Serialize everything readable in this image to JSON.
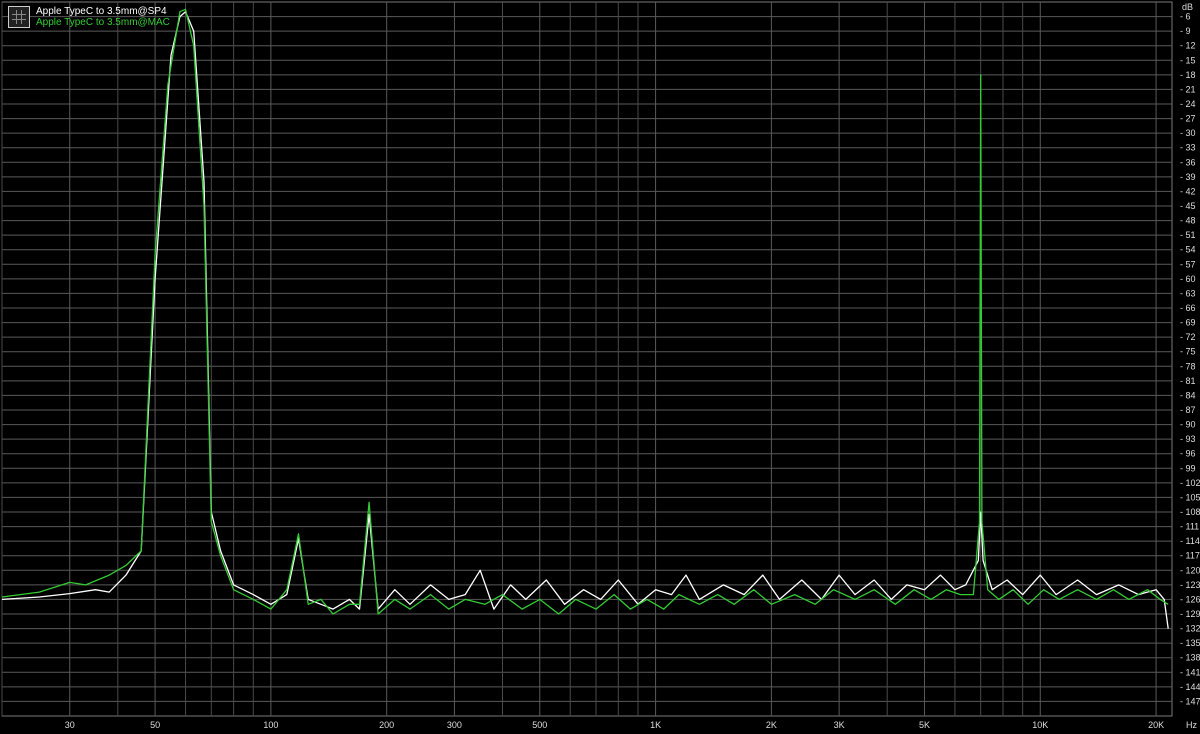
{
  "chart_data": {
    "type": "line",
    "title": "",
    "x_scale": "log",
    "xlim": [
      20,
      22000
    ],
    "ylim": [
      -150,
      -3
    ],
    "y_unit": "dB",
    "x_unit": "Hz",
    "grid": true,
    "legend_position": "top-left",
    "x_ticks": [
      {
        "value": 30,
        "label": "30"
      },
      {
        "value": 50,
        "label": "50"
      },
      {
        "value": 100,
        "label": "100"
      },
      {
        "value": 200,
        "label": "200"
      },
      {
        "value": 300,
        "label": "300"
      },
      {
        "value": 500,
        "label": "500"
      },
      {
        "value": 1000,
        "label": "1K"
      },
      {
        "value": 2000,
        "label": "2K"
      },
      {
        "value": 3000,
        "label": "3K"
      },
      {
        "value": 5000,
        "label": "5K"
      },
      {
        "value": 10000,
        "label": "10K"
      },
      {
        "value": 20000,
        "label": "20K"
      }
    ],
    "x_minor_grid": [
      20,
      40,
      60,
      70,
      80,
      90,
      400,
      600,
      700,
      800,
      900,
      4000,
      6000,
      7000,
      8000,
      9000
    ],
    "y_ticks": [
      -6,
      -9,
      -12,
      -15,
      -18,
      -21,
      -24,
      -27,
      -30,
      -33,
      -36,
      -39,
      -42,
      -45,
      -48,
      -51,
      -54,
      -57,
      -60,
      -63,
      -66,
      -69,
      -72,
      -75,
      -78,
      -81,
      -84,
      -87,
      -90,
      -93,
      -96,
      -99,
      -102,
      -105,
      -108,
      -111,
      -114,
      -117,
      -120,
      -123,
      -126,
      -129,
      -132,
      -135,
      -138,
      -141,
      -144,
      -147
    ],
    "series": [
      {
        "name": "Apple TypeC to 3.5mm@SP4",
        "color": "#ffffff",
        "points": [
          [
            20,
            -126
          ],
          [
            25,
            -125.5
          ],
          [
            30,
            -124.8
          ],
          [
            35,
            -124
          ],
          [
            38,
            -124.5
          ],
          [
            42,
            -121
          ],
          [
            46,
            -116
          ],
          [
            50,
            -60
          ],
          [
            55,
            -14
          ],
          [
            58,
            -6
          ],
          [
            60,
            -5
          ],
          [
            63,
            -9
          ],
          [
            67,
            -40
          ],
          [
            70,
            -108
          ],
          [
            74,
            -116
          ],
          [
            80,
            -123
          ],
          [
            90,
            -125
          ],
          [
            100,
            -127
          ],
          [
            110,
            -125
          ],
          [
            118,
            -113.5
          ],
          [
            125,
            -126
          ],
          [
            135,
            -127
          ],
          [
            145,
            -128
          ],
          [
            160,
            -126
          ],
          [
            170,
            -128
          ],
          [
            180,
            -108.5
          ],
          [
            190,
            -128
          ],
          [
            210,
            -124
          ],
          [
            230,
            -127
          ],
          [
            260,
            -123
          ],
          [
            290,
            -126
          ],
          [
            320,
            -125
          ],
          [
            350,
            -120
          ],
          [
            380,
            -128
          ],
          [
            420,
            -123
          ],
          [
            460,
            -126
          ],
          [
            520,
            -122
          ],
          [
            580,
            -127
          ],
          [
            650,
            -124
          ],
          [
            720,
            -126
          ],
          [
            800,
            -122
          ],
          [
            900,
            -127
          ],
          [
            1000,
            -124
          ],
          [
            1100,
            -125
          ],
          [
            1200,
            -121
          ],
          [
            1300,
            -126
          ],
          [
            1500,
            -123
          ],
          [
            1700,
            -125
          ],
          [
            1900,
            -121
          ],
          [
            2100,
            -126
          ],
          [
            2400,
            -122
          ],
          [
            2700,
            -126
          ],
          [
            3000,
            -121
          ],
          [
            3300,
            -125
          ],
          [
            3700,
            -122
          ],
          [
            4100,
            -126
          ],
          [
            4500,
            -123
          ],
          [
            5000,
            -124
          ],
          [
            5500,
            -121
          ],
          [
            6000,
            -124
          ],
          [
            6400,
            -123
          ],
          [
            6900,
            -118
          ],
          [
            7000,
            -108
          ],
          [
            7100,
            -118
          ],
          [
            7500,
            -124
          ],
          [
            8200,
            -122
          ],
          [
            9000,
            -125
          ],
          [
            10000,
            -121
          ],
          [
            11000,
            -125
          ],
          [
            12500,
            -122
          ],
          [
            14000,
            -125
          ],
          [
            16000,
            -123
          ],
          [
            18000,
            -125
          ],
          [
            20000,
            -124
          ],
          [
            21000,
            -126
          ],
          [
            21500,
            -132
          ]
        ]
      },
      {
        "name": "Apple TypeC to 3.5mm@MAC",
        "color": "#33cc33",
        "points": [
          [
            20,
            -125.5
          ],
          [
            25,
            -124.5
          ],
          [
            30,
            -122.5
          ],
          [
            33,
            -123
          ],
          [
            38,
            -121
          ],
          [
            42,
            -119
          ],
          [
            46,
            -116
          ],
          [
            50,
            -55
          ],
          [
            54,
            -20
          ],
          [
            58,
            -5
          ],
          [
            60,
            -4.5
          ],
          [
            63,
            -12
          ],
          [
            67,
            -45
          ],
          [
            70,
            -110
          ],
          [
            74,
            -117
          ],
          [
            80,
            -124
          ],
          [
            90,
            -126
          ],
          [
            100,
            -128
          ],
          [
            110,
            -124
          ],
          [
            118,
            -112.5
          ],
          [
            125,
            -127
          ],
          [
            135,
            -126
          ],
          [
            145,
            -129
          ],
          [
            160,
            -127
          ],
          [
            170,
            -127
          ],
          [
            180,
            -106
          ],
          [
            190,
            -129
          ],
          [
            210,
            -126
          ],
          [
            230,
            -128
          ],
          [
            260,
            -125
          ],
          [
            290,
            -128
          ],
          [
            320,
            -126
          ],
          [
            360,
            -127
          ],
          [
            400,
            -125
          ],
          [
            450,
            -128
          ],
          [
            500,
            -126
          ],
          [
            560,
            -129
          ],
          [
            620,
            -126
          ],
          [
            700,
            -128
          ],
          [
            780,
            -125
          ],
          [
            860,
            -128
          ],
          [
            950,
            -126
          ],
          [
            1050,
            -128
          ],
          [
            1150,
            -125
          ],
          [
            1300,
            -127
          ],
          [
            1450,
            -125
          ],
          [
            1600,
            -127
          ],
          [
            1800,
            -124
          ],
          [
            2000,
            -127
          ],
          [
            2300,
            -125
          ],
          [
            2600,
            -127
          ],
          [
            2900,
            -124
          ],
          [
            3300,
            -126
          ],
          [
            3700,
            -124
          ],
          [
            4200,
            -127
          ],
          [
            4700,
            -124
          ],
          [
            5200,
            -126
          ],
          [
            5700,
            -124
          ],
          [
            6200,
            -125
          ],
          [
            6700,
            -125
          ],
          [
            6950,
            -110
          ],
          [
            7000,
            -18
          ],
          [
            7050,
            -110
          ],
          [
            7300,
            -124
          ],
          [
            7800,
            -126
          ],
          [
            8500,
            -124
          ],
          [
            9300,
            -127
          ],
          [
            10200,
            -124
          ],
          [
            11200,
            -126
          ],
          [
            12500,
            -124
          ],
          [
            14000,
            -126
          ],
          [
            15500,
            -124
          ],
          [
            17000,
            -126
          ],
          [
            19000,
            -124
          ],
          [
            20500,
            -126
          ],
          [
            21500,
            -127
          ]
        ]
      }
    ]
  }
}
